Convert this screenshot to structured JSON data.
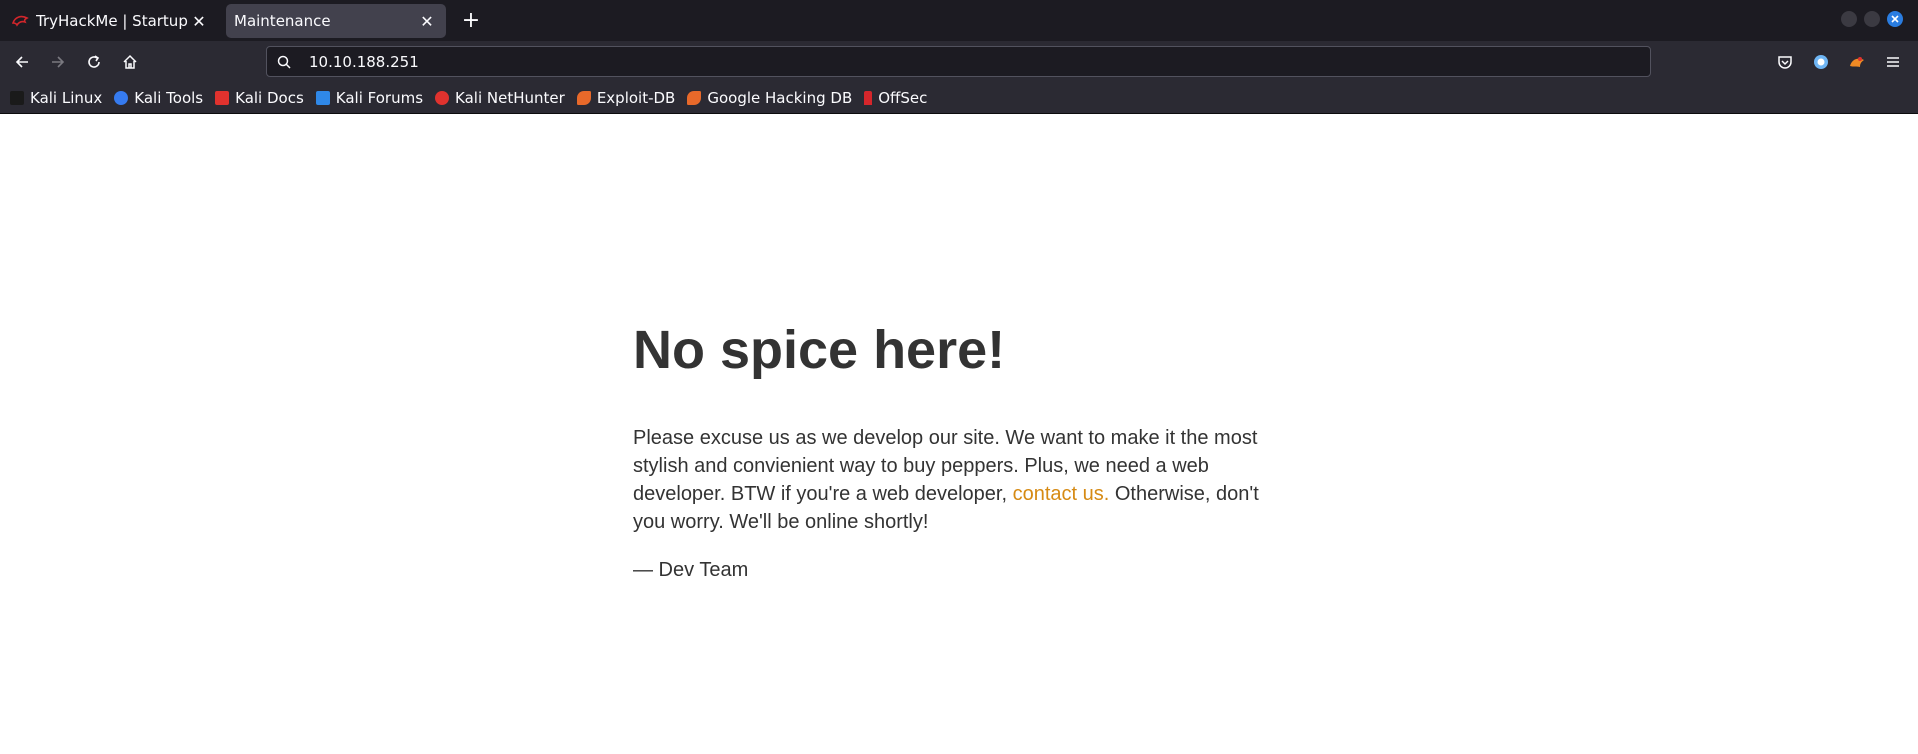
{
  "tabs": [
    {
      "title": "TryHackMe | Startup",
      "active": false,
      "icon": "kali-dragon-icon"
    },
    {
      "title": "Maintenance",
      "active": true,
      "icon": "none"
    }
  ],
  "window_controls": [
    "minimize",
    "maximize",
    "close"
  ],
  "nav": {
    "back": "back-arrow-icon",
    "forward": "forward-arrow-icon",
    "reload": "reload-icon",
    "home": "home-icon"
  },
  "url": "10.10.188.251",
  "toolbar_right": [
    "pocket-icon",
    "account-icon",
    "extension-icon",
    "menu-icon"
  ],
  "bookmarks": [
    {
      "label": "Kali Linux",
      "color": "#1a1a1a"
    },
    {
      "label": "Kali Tools",
      "color": "#367bf0"
    },
    {
      "label": "Kali Docs",
      "color": "#e0322e"
    },
    {
      "label": "Kali Forums",
      "color": "#2f88e8"
    },
    {
      "label": "Kali NetHunter",
      "color": "#e0322e"
    },
    {
      "label": "Exploit-DB",
      "color": "#e8692a"
    },
    {
      "label": "Google Hacking DB",
      "color": "#e8692a"
    },
    {
      "label": "OffSec",
      "color": "#d6262b"
    }
  ],
  "page": {
    "heading": "No spice here!",
    "message_part1": "Please excuse us as we develop our site. We want to make it the most stylish and convienient way to buy peppers. Plus, we need a web developer. BTW if you're a web developer, ",
    "link_text": "contact us.",
    "message_part2": " Otherwise, don't you worry. We'll be online shortly!",
    "signature": "— Dev Team"
  },
  "colors": {
    "link": "#d68a13",
    "text": "#333333",
    "close_button": "#2a7de1"
  }
}
